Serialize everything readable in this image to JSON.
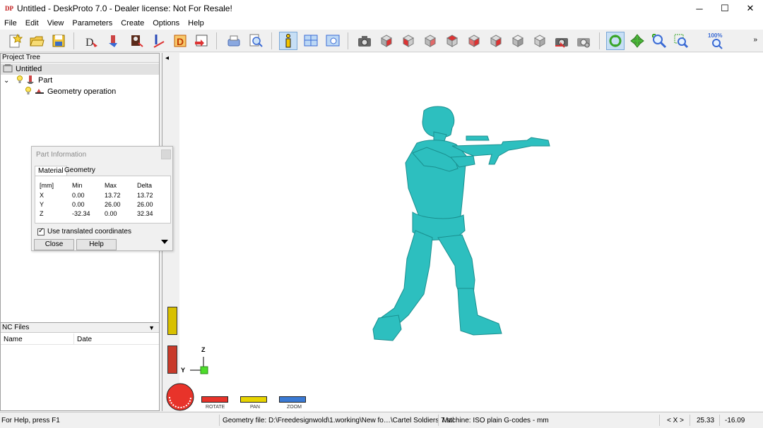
{
  "window": {
    "app_icon": "DP",
    "title": "Untitled - DeskProto 7.0 - Dealer license: Not For Resale!",
    "minimize": "─",
    "maximize": "☐",
    "close": "✕"
  },
  "menu": [
    "File",
    "Edit",
    "View",
    "Parameters",
    "Create",
    "Options",
    "Help"
  ],
  "toolbar": {
    "zoom_label": "100%",
    "more": "»",
    "active_tool": "part-information-icon"
  },
  "project_tree": {
    "header": "Project Tree",
    "root": "Untitled",
    "expander": "⌄",
    "part": "Part",
    "operation": "Geometry operation"
  },
  "nc_files": {
    "header": "NC Files",
    "arrow": "▼",
    "columns": [
      "Name",
      "Date"
    ]
  },
  "part_info": {
    "title": "Part Information",
    "tabs": [
      "Material",
      "Geometry"
    ],
    "active_tab": "Material",
    "headers": [
      "[mm]",
      "Min",
      "Max",
      "Delta"
    ],
    "rows": [
      {
        "axis": "X",
        "min": "0.00",
        "max": "13.72",
        "delta": "13.72"
      },
      {
        "axis": "Y",
        "min": "0.00",
        "max": "26.00",
        "delta": "26.00"
      },
      {
        "axis": "Z",
        "min": "-32.34",
        "max": "0.00",
        "delta": "32.34"
      }
    ],
    "checkbox_label": "Use translated coordinates",
    "checkbox_checked": true,
    "close_label": "Close",
    "help_label": "Help"
  },
  "viewport": {
    "collapse_arrow": "◂",
    "axis_z": "Z",
    "axis_y": "Y",
    "model_color": "#2dbfbf",
    "rotate_label": "ROTATE",
    "pan_label": "PAN",
    "zoom_label": "ZOOM"
  },
  "status": {
    "help": "For Help, press F1",
    "geometry_file": "Geometry file: D:\\Freedesignwold\\1.working\\New fo…\\Cartel Soldiers 7.stl",
    "machine": "Machine: ISO plain G-codes - mm",
    "axes": "< X >",
    "coord_1": "25.33",
    "coord_2": "-16.09"
  }
}
